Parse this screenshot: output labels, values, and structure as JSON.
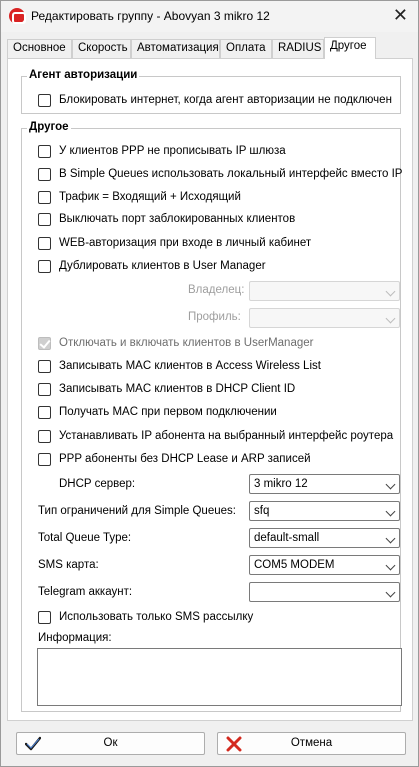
{
  "window": {
    "title": "Редактировать группу - Abovyan 3 mikro 12"
  },
  "tabs": [
    "Основное",
    "Скорость",
    "Автоматизация",
    "Оплата",
    "RADIUS",
    "Другое"
  ],
  "active_tab": "Другое",
  "auth_agent": {
    "legend": "Агент авторизации",
    "block_internet": "Блокировать интернет, когда агент авторизации не подключен"
  },
  "other": {
    "legend": "Другое",
    "checkboxes": [
      "У клиентов PPP не прописывать IP шлюза",
      "В Simple Queues использовать локальный интерфейс вместо IP",
      "Трафик = Входящий + Исходящий",
      "Выключать порт заблокированных клиентов",
      "WEB-авторизация при входе в личный кабинет",
      "Дублировать клиентов в User Manager"
    ],
    "owner_label": "Владелец:",
    "owner_value": "",
    "profile_label": "Профиль:",
    "profile_value": "",
    "usermanager_toggle": "Отключать и включать клиентов в UserManager",
    "checkboxes2": [
      "Записывать MAC клиентов в Access Wireless List",
      "Записывать MAC клиентов в DHCP Client ID",
      "Получать MAC при первом подключении",
      "Устанавливать IP абонента на выбранный интерфейс роутера",
      "PPP абоненты без DHCP Lease и ARP записей"
    ],
    "dhcp_label": "DHCP сервер:",
    "dhcp_value": "3 mikro 12",
    "limit_type_label": "Тип ограничений для Simple Queues:",
    "limit_type_value": "sfq",
    "queue_type_label": "Total Queue Type:",
    "queue_type_value": "default-small",
    "sms_label": "SMS карта:",
    "sms_value": "COM5 MODEM",
    "telegram_label": "Telegram аккаунт:",
    "telegram_value": "",
    "sms_only": "Использовать только SMS рассылку",
    "info_label": "Информация:",
    "info_value": ""
  },
  "buttons": {
    "ok": "Ок",
    "cancel": "Отмена"
  }
}
